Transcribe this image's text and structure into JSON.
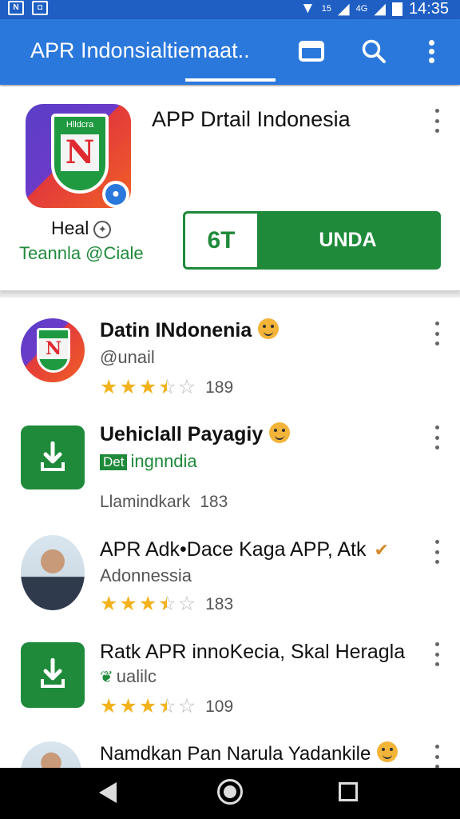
{
  "status_bar": {
    "left_icons": [
      "notification-icon",
      "photo-icon"
    ],
    "right_icons": [
      "wifi-icon",
      "signal-icon",
      "battery-icon"
    ],
    "signal_labels": [
      "15",
      "4G"
    ],
    "time": "14:35"
  },
  "app_bar": {
    "title": "APR Indonsialtiemaat..",
    "icons": [
      "window-icon",
      "search-icon",
      "more-vert-icon"
    ],
    "color": "#2b78dc"
  },
  "detail": {
    "title": "APP Drtail  Indonesia",
    "logo_text": "Hlldcra",
    "logo_letter": "N",
    "publisher": "Heal",
    "subtitle": "Teannla @Ciale",
    "install_icon": "6T",
    "install_label": "UNDA",
    "accent": "#1e8a3a"
  },
  "apps": [
    {
      "title": "Datin INdonenia",
      "subtitle": "@unail",
      "rating": 3.5,
      "count": "189",
      "thumb": "logo",
      "title_bold": true
    },
    {
      "title": "Uehiclall Payagiy",
      "subtitle_badge": "Det",
      "subtitle": "ingnndia",
      "meta_text": "Llamindkark",
      "count": "183",
      "thumb": "download",
      "title_bold": true
    },
    {
      "title": "APR Adk•Dace Kaga APP, Atk",
      "subtitle": "Adonnessia",
      "rating": 3.5,
      "count": "183",
      "thumb": "person",
      "title_bold": false
    },
    {
      "title": "Ratk APR innoKecia, Skal Heragla",
      "subtitle": "ualilc",
      "rating": 3.5,
      "count": "109",
      "thumb": "download",
      "title_bold": false
    },
    {
      "title": "Namdkan Pan Narula Yadankile",
      "thumb": "person",
      "title_bold": false
    }
  ],
  "nav_bar": {
    "icons": [
      "back-icon",
      "home-icon",
      "recents-icon"
    ]
  }
}
